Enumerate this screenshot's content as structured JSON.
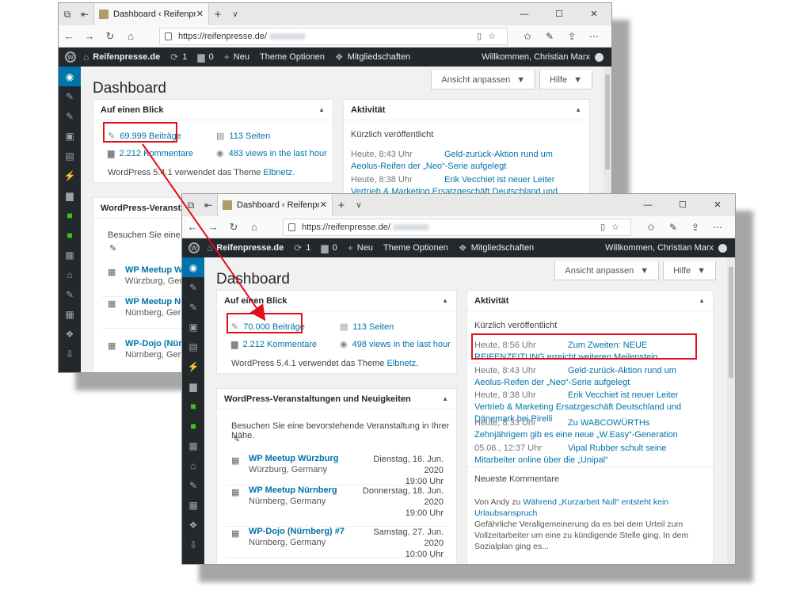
{
  "browser": {
    "tab_title": "Dashboard ‹ Reifenpres",
    "url": "https://reifenpresse.de/"
  },
  "adminbar": {
    "site": "Reifenpresse.de",
    "updates": "1",
    "comments": "0",
    "new": "Neu",
    "theme": "Theme Optionen",
    "members": "Mitgliedschaften",
    "welcome": "Willkommen, Christian Marx"
  },
  "page": {
    "title": "Dashboard",
    "screen_options": "Ansicht anpassen",
    "help": "Hilfe"
  },
  "glance": {
    "title": "Auf einen Blick",
    "pages": "113 Seiten",
    "comments": "2.212 Kommentare",
    "version_pre": "WordPress 5.4.1 verwendet das Theme ",
    "theme": "Elbnetz",
    "version_post": "."
  },
  "window1": {
    "posts": "69.999 Beiträge",
    "views": "483 views in the last hour",
    "events_title": "WordPress-Veranstaltu",
    "events_intro": "Besuchen Sie eine bev",
    "ev1": "WP Meetup Würz",
    "ev1_loc": "Würzburg, Germany",
    "ev2": "WP Meetup Nürnb",
    "ev2_loc": "Nürnberg, Germany",
    "ev3": "WP-Dojo (Nürnb",
    "ev3_loc": "Nürnberg, Germany",
    "comments_short": "2.212 Kommentare"
  },
  "window2": {
    "posts": "70.000 Beiträge",
    "views": "498 views in the last hour"
  },
  "activity": {
    "title": "Aktivität",
    "recent": "Kürzlich veröffentlicht",
    "items": [
      {
        "date": "Heute, 8:56 Uhr",
        "title": "Zum Zweiten: NEUE REIFENZEITUNG erreicht weiteren Meilenstein"
      },
      {
        "date": "Heute, 8:43 Uhr",
        "title": "Geld-zurück-Aktion rund um Aeolus-Reifen der „Neo“-Serie aufgelegt"
      },
      {
        "date": "Heute, 8:38 Uhr",
        "title": "Erik Vecchiet ist neuer Leiter Vertrieb & Marketing Ersatzgeschäft Deutschland und Dänemark bei Pirelli"
      },
      {
        "date": "Heute, 8:33 Uhr",
        "title": "Zu WABCOWÜRTHs Zehnjährigem gib es eine neue „W.Easy“-Generation"
      },
      {
        "date": "05.06., 12:37 Uhr",
        "title": "Vipal Rubber schult seine Mitarbeiter online über die „Unipal“"
      }
    ],
    "w1_items": [
      {
        "date": "Heute, 8:43 Uhr",
        "title": "Geld-zurück-Aktion rund um Aeolus-Reifen der „Neo“-Serie aufgelegt"
      },
      {
        "date": "Heute, 8:38 Uhr",
        "title": "Erik Vecchiet ist neuer Leiter Vertrieb & Marketing Ersatzgeschäft Deutschland und Dänemark bei Pirelli"
      }
    ],
    "comments_title": "Neueste Kommentare",
    "comment_from": "Von Andy zu ",
    "comment_link": "Während „Kurzarbeit Null“ entsteht kein Urlaubsanspruch",
    "comment_text": "Gefährliche Verallgemeinerung da es bei dem Urteil zum Vollzeitarbeiter um eine zu kündigende Stelle ging. In dem Sozialplan ging es..."
  },
  "events": {
    "title": "WordPress-Veranstaltungen und Neuigkeiten",
    "intro": "Besuchen Sie eine bevorstehende Veranstaltung in Ihrer Nähe.",
    "items": [
      {
        "name": "WP Meetup Würzburg",
        "loc": "Würzburg, Germany",
        "date": "Dienstag, 16. Jun. 2020",
        "time": "19:00 Uhr"
      },
      {
        "name": "WP Meetup Nürnberg",
        "loc": "Nürnberg, Germany",
        "date": "Donnerstag, 18. Jun. 2020",
        "time": "19:00 Uhr"
      },
      {
        "name": "WP-Dojo (Nürnberg) #7",
        "loc": "Nürnberg, Germany",
        "date": "Samstag, 27. Jun. 2020",
        "time": "10:00 Uhr"
      }
    ]
  },
  "colors": {
    "highlight": "#e0101a",
    "link": "#0073aa",
    "adminbar": "#23282d"
  }
}
